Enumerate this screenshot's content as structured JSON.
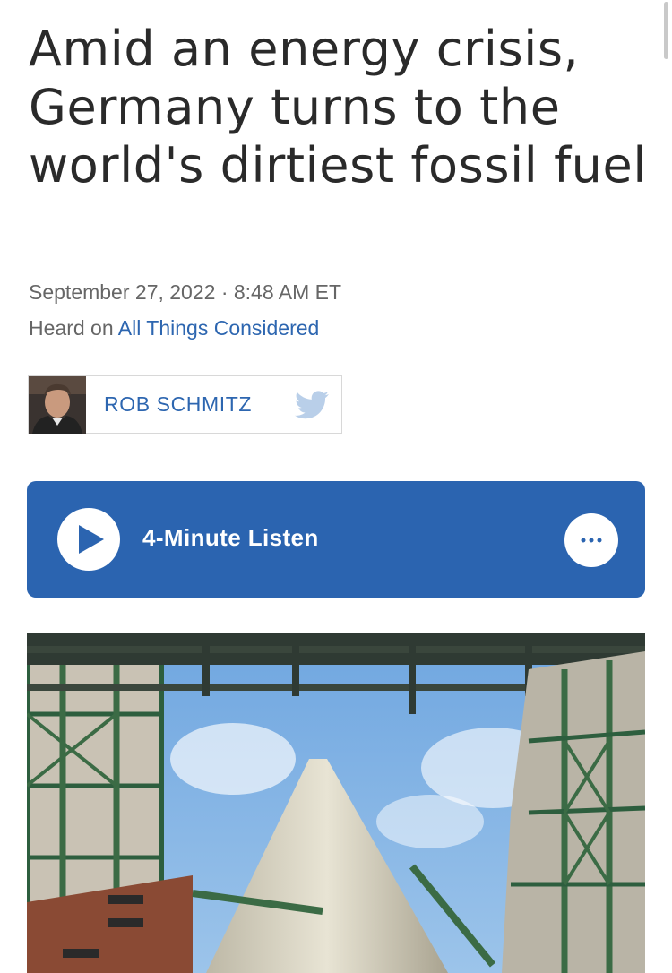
{
  "article": {
    "headline": "Amid an energy crisis, Germany turns to the world's dirtiest fossil fuel",
    "dateline": "September 27, 2022 · 8:48 AM ET",
    "heard_on_prefix": "Heard on ",
    "heard_on_program": "All Things Considered"
  },
  "byline": {
    "author_name": "ROB SCHMITZ",
    "avatar_icon": "author-photo",
    "social_icon": "twitter-icon"
  },
  "audio_player": {
    "play_icon": "play-icon",
    "listen_label": "4-Minute Listen",
    "more_icon": "ellipsis-icon"
  },
  "lead_image": {
    "description_icon": "photo"
  },
  "colors": {
    "accent": "#2b64b0",
    "link": "#2d66b0",
    "text": "#2a2a2a",
    "muted": "#666666"
  }
}
